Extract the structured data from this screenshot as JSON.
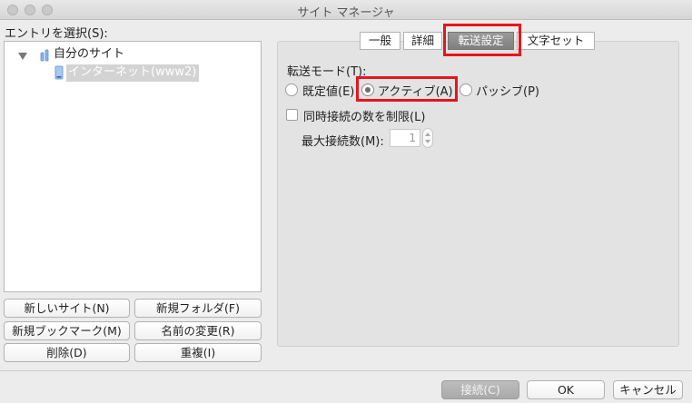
{
  "window": {
    "title": "サイト マネージャ"
  },
  "left": {
    "select_label": "エントリを選択(S):",
    "tree": {
      "folder_label": "自分のサイト",
      "site_label": "インターネット(www2)"
    },
    "buttons": {
      "new_site": "新しいサイト(N)",
      "new_folder": "新規フォルダ(F)",
      "new_bookmark": "新規ブックマーク(M)",
      "rename": "名前の変更(R)",
      "delete": "削除(D)",
      "duplicate": "重複(I)"
    }
  },
  "tabs": [
    {
      "label": "一般"
    },
    {
      "label": "詳細"
    },
    {
      "label": "転送設定"
    },
    {
      "label": "文字セット"
    }
  ],
  "transfer": {
    "mode_label": "転送モード(T):",
    "modes": [
      {
        "label": "既定値(E)",
        "checked": false
      },
      {
        "label": "アクティブ(A)",
        "checked": true
      },
      {
        "label": "パッシブ(P)",
        "checked": false
      }
    ],
    "limit_label": "同時接続の数を制限(L)",
    "limit_checked": false,
    "max_label": "最大接続数(M):",
    "max_value": "1"
  },
  "footer": {
    "connect": "接続(C)",
    "ok": "OK",
    "cancel": "キャンセル"
  },
  "colors": {
    "highlight": "#e8141c",
    "active_tab": "#8a8a8a",
    "selection": "#d3d3d3"
  }
}
